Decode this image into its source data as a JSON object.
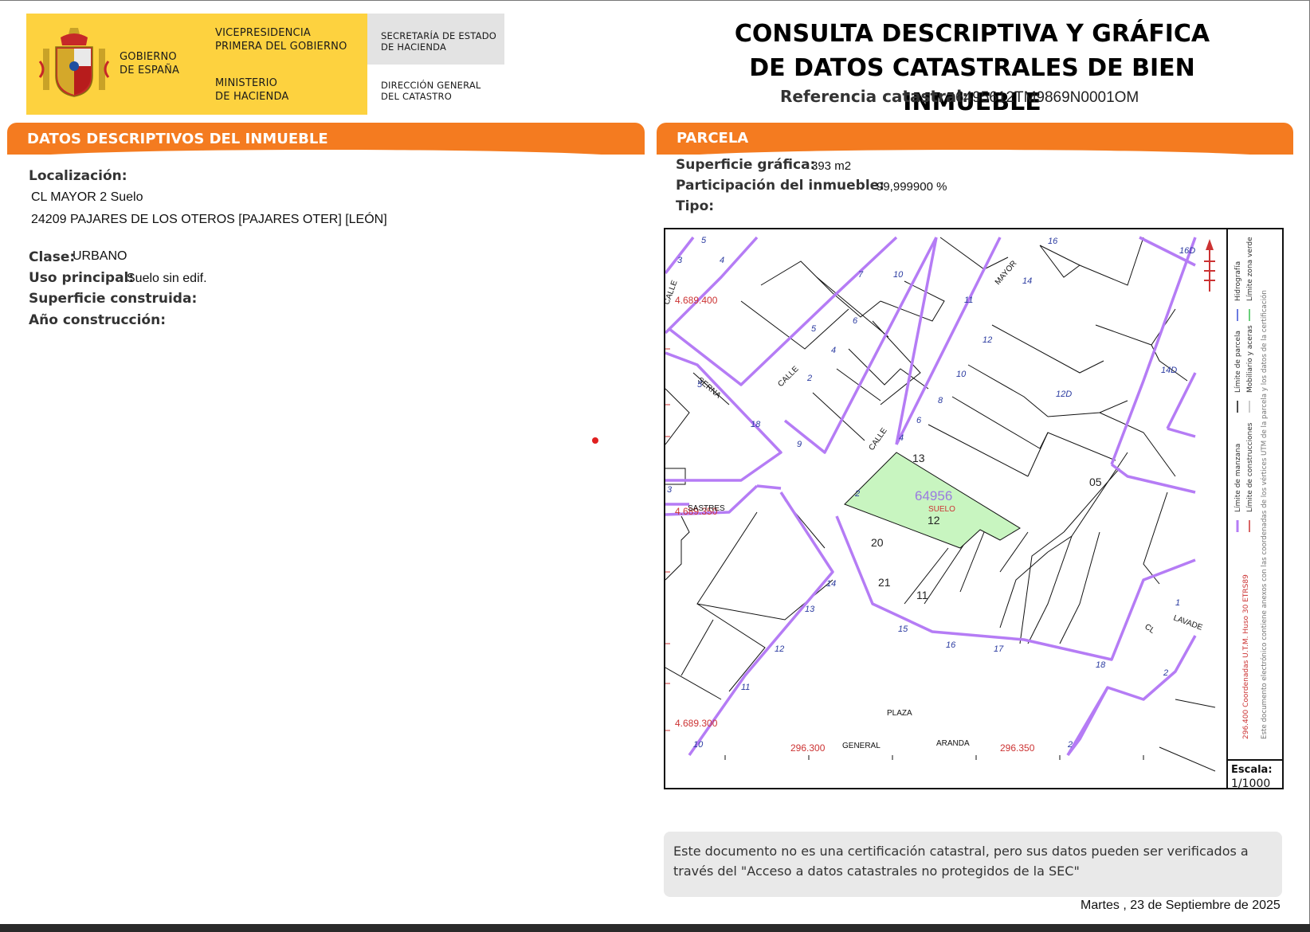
{
  "header": {
    "gov_line1": "GOBIERNO",
    "gov_line2": "DE ESPAÑA",
    "vice_line1": "VICEPRESIDENCIA",
    "vice_line2": "PRIMERA DEL GOBIERNO",
    "min_line1": "MINISTERIO",
    "min_line2": "DE HACIENDA",
    "sec_line1": "SECRETARÍA DE ESTADO",
    "sec_line2": "DE HACIENDA",
    "dg_line1": "DIRECCIÓN GENERAL",
    "dg_line2": "DEL CATASTRO",
    "title_line1": "CONSULTA DESCRIPTIVA Y GRÁFICA",
    "title_line2": "DE DATOS CATASTRALES DE BIEN INMUEBLE",
    "ref_label": "Referencia catastral:",
    "ref_value": "6495612TM9869N0001OM",
    "colors": {
      "brand_yellow": "#fdd23f",
      "section_orange": "#f47b20"
    }
  },
  "left": {
    "section_title": "DATOS DESCRIPTIVOS DEL INMUEBLE",
    "loc_label": "Localización:",
    "loc_line1": "CL MAYOR 2 Suelo",
    "loc_line2": "24209 PAJARES DE LOS OTEROS [PAJARES OTER] [LEÓN]",
    "clase_label": "Clase:",
    "clase_value": "URBANO",
    "uso_label": "Uso principal:",
    "uso_value": "Suelo sin edif.",
    "sup_label": "Superficie construida:",
    "anio_label": "Año construcción:"
  },
  "right": {
    "section_title": "PARCELA",
    "sup_label": "Superficie gráfica:",
    "sup_value": "393 m2",
    "part_label": "Participación del inmueble:",
    "part_value": "99,999900 %",
    "tipo_label": "Tipo:"
  },
  "map": {
    "parcel_ref": "64956",
    "parcel_use": "SUELO",
    "numbers": [
      "13",
      "12",
      "20",
      "21",
      "11",
      "05"
    ],
    "coords": {
      "y1": "4.689.400",
      "y2": "4.689.350",
      "y3": "4.689.300",
      "x1": "296.300",
      "x2": "296.350"
    },
    "streets": [
      "CALLE",
      "SERNA",
      "CALLE",
      "CALLE",
      "MAYOR",
      "SASTRES",
      "PLAZA",
      "GENERAL",
      "ARANDA",
      "CL",
      "LAVADE"
    ],
    "portals": [
      "5",
      "3",
      "4",
      "7",
      "10",
      "11",
      "16",
      "14",
      "12",
      "10",
      "8",
      "6",
      "4",
      "2",
      "6",
      "4",
      "2",
      "5",
      "18",
      "14",
      "13",
      "12",
      "11",
      "10",
      "15",
      "16",
      "17",
      "18",
      "1",
      "2",
      "2",
      "12D",
      "14D",
      "16D",
      "9",
      "3",
      "5"
    ],
    "legend_l1": "Límite de manzana",
    "legend_l2": "Límite de construcciones",
    "legend_l3": "Límite de parcela",
    "legend_l4": "Mobiliario y aceras",
    "legend_l5": "Hidrografía",
    "legend_l6": "Límite zona verde",
    "legend_coords": "296.400 Coordenadas U.T.M. Huso 30 ETRS89",
    "legend_note": "Este documento electrónico contiene anexos con las coordenadas de los vértices UTM de la parcela y los datos de la certificación",
    "scale_label": "Escala:",
    "scale_value": "1/1000",
    "colors": {
      "block": "#b57cf5",
      "parcel_fill": "#c8f5c0",
      "coord": "#cc3333",
      "portal": "#2a3aa0"
    }
  },
  "footer": {
    "note": "Este documento no es una certificación catastral, pero sus datos pueden ser verificados a través del \"Acceso a datos catastrales no protegidos de la SEC\"",
    "date": "Martes , 23 de Septiembre de 2025"
  }
}
